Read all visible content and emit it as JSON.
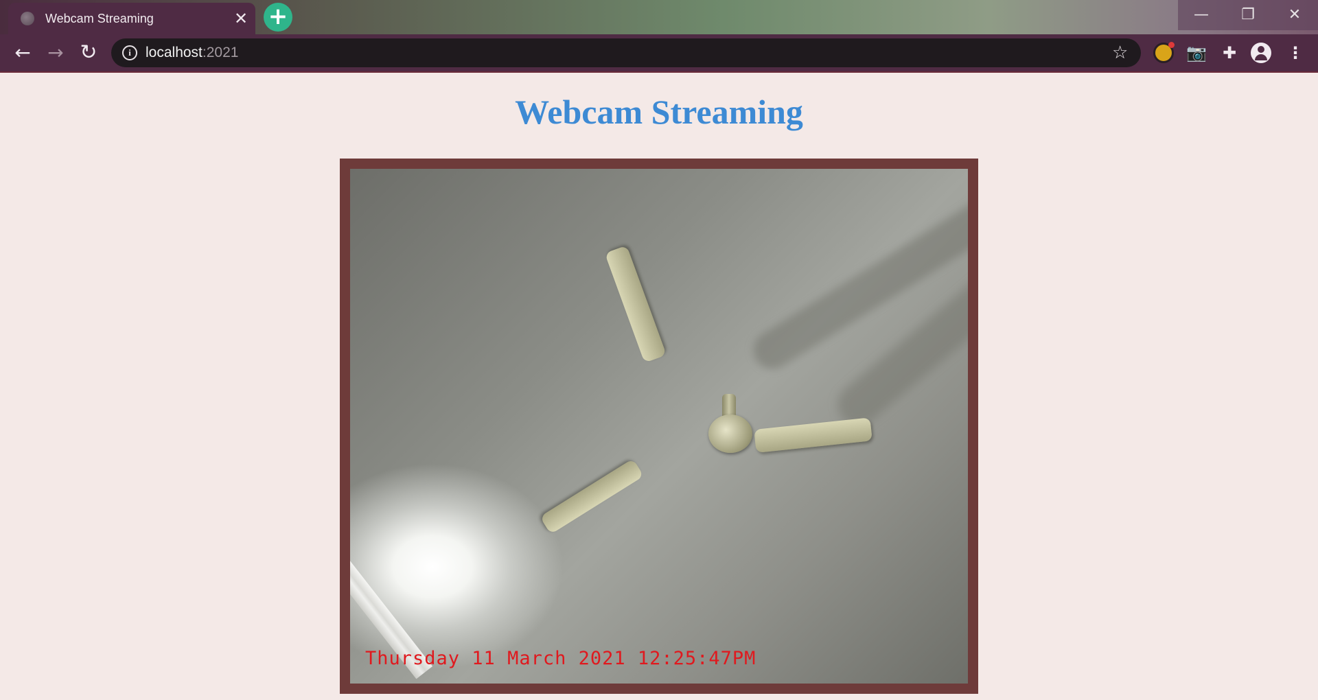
{
  "browser": {
    "tab_title": "Webcam Streaming",
    "tab_close": "✕",
    "new_tab": "+",
    "url_host": "localhost",
    "url_port": ":2021",
    "window_controls": {
      "minimize": "—",
      "maximize": "❐",
      "close": "✕"
    },
    "nav": {
      "back": "←",
      "forward": "→",
      "reload": "↻"
    },
    "star": "☆",
    "icons": [
      "extension-badge-icon",
      "camera-icon",
      "puzzle-extensions-icon",
      "profile-avatar-icon",
      "more-menu-icon"
    ],
    "icon_glyphs": {
      "camera": "📷",
      "puzzle": "✚",
      "more": "⋮"
    }
  },
  "page": {
    "title": "Webcam Streaming",
    "title_color": "#3d8ad4",
    "background": "#f4e9e7",
    "frame_color": "#6e3b3a"
  },
  "stream": {
    "timestamp": "Thursday 11 March 2021 12:25:47PM",
    "timestamp_color": "#e0191e"
  }
}
